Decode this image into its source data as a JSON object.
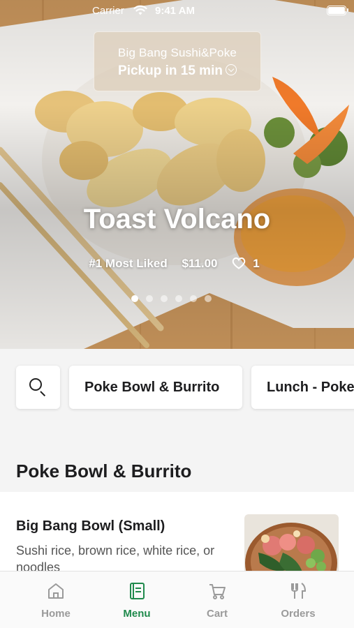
{
  "status_bar": {
    "carrier": "Carrier",
    "time": "9:41 AM"
  },
  "store": {
    "name": "Big Bang Sushi&Poke",
    "pickup": "Pickup in 15 min"
  },
  "hero": {
    "title": "Toast Volcano",
    "badge": "#1 Most Liked",
    "price": "$11.00",
    "likes": "1",
    "slides_total": 6,
    "slide_active": 1
  },
  "categories": {
    "search_icon": "search-icon",
    "chips": [
      "Poke Bowl & Burrito",
      "Lunch - Poke"
    ]
  },
  "section": {
    "title": "Poke Bowl & Burrito"
  },
  "menu_items": [
    {
      "name": "Big Bang Bowl (Small)",
      "description": "Sushi rice, brown rice, white rice, or noodles"
    }
  ],
  "tabs": [
    {
      "label": "Home",
      "icon": "home-icon",
      "active": false
    },
    {
      "label": "Menu",
      "icon": "menu-book-icon",
      "active": true
    },
    {
      "label": "Cart",
      "icon": "cart-icon",
      "active": false
    },
    {
      "label": "Orders",
      "icon": "utensils-icon",
      "active": false
    }
  ],
  "colors": {
    "accent": "#1f8a4c",
    "inactive": "#9a9a9a"
  }
}
